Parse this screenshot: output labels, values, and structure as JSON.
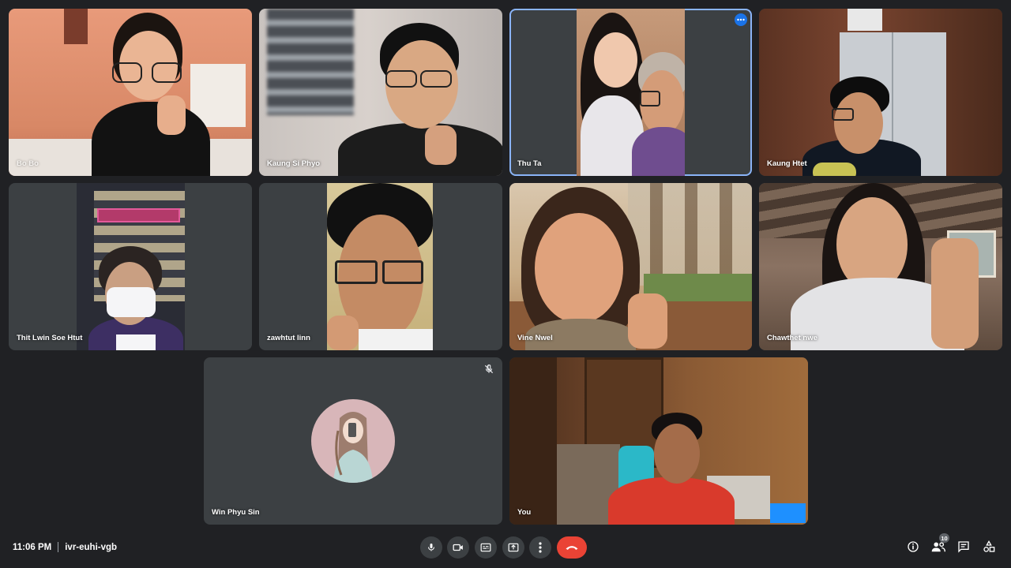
{
  "participants": [
    {
      "name": "Bo Bo"
    },
    {
      "name": "Kaung Si Phyo"
    },
    {
      "name": "Thu Ta"
    },
    {
      "name": "Kaung Htet"
    },
    {
      "name": "Thit Lwin Soe Htut"
    },
    {
      "name": "zawhtut linn"
    },
    {
      "name": "Vine Nwel"
    },
    {
      "name": "Chawthet nwe"
    },
    {
      "name": "Win Phyu Sin"
    },
    {
      "name": "You"
    }
  ],
  "footer": {
    "time": "11:06 PM",
    "meeting_code": "ivr-euhi-vgb"
  },
  "people_count": "10",
  "icons": {
    "mic": "microphone-icon",
    "camera": "camera-icon",
    "captions": "captions-icon",
    "present": "present-screen-icon",
    "more": "more-options-icon",
    "end": "end-call-icon",
    "info": "info-icon",
    "people": "people-icon",
    "chat": "chat-icon",
    "activities": "activities-icon",
    "muted": "mic-off-icon"
  },
  "colors": {
    "background": "#202124",
    "tile": "#3c4043",
    "active_border": "#8ab4f8",
    "end_call": "#ea4335",
    "more_button": "#1a73e8"
  }
}
